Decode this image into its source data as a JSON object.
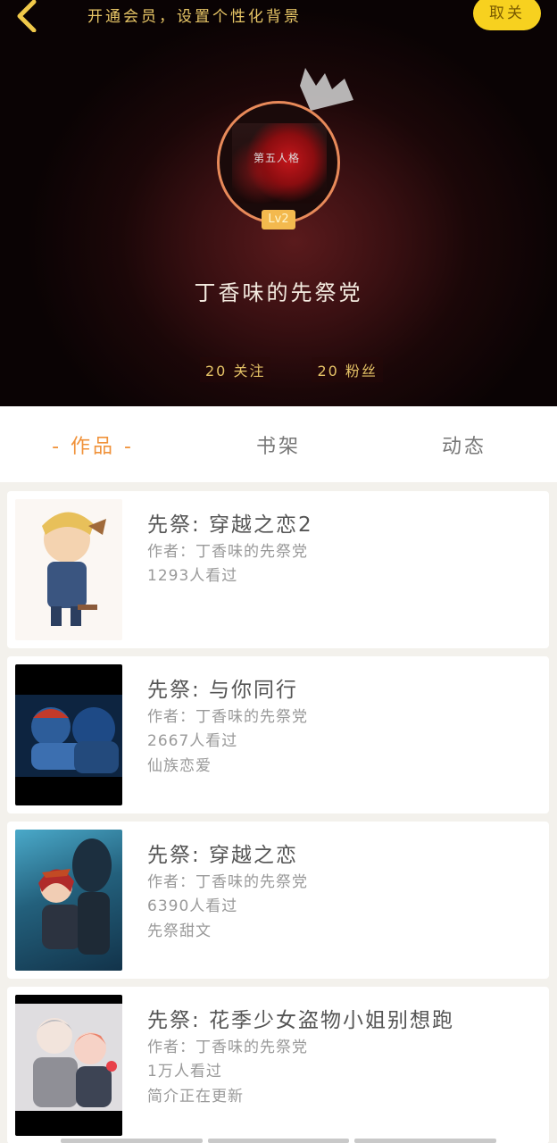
{
  "header": {
    "vip_tip": "开通会员，设置个性化背景",
    "follow_label": "取关",
    "username": "丁香味的先祭党",
    "level": "Lv2",
    "avatar_caption": "第五人格",
    "following": "20 关注",
    "followers": "20 粉丝"
  },
  "tabs": [
    {
      "label": "- 作品 -",
      "active": true
    },
    {
      "label": "书架",
      "active": false
    },
    {
      "label": "动态",
      "active": false
    }
  ],
  "works": [
    {
      "title": "先祭:  穿越之恋2",
      "author": "作者：丁香味的先祭党",
      "views": "1293人看过",
      "tag": ""
    },
    {
      "title": "先祭:  与你同行",
      "author": "作者：丁香味的先祭党",
      "views": "2667人看过",
      "tag": "仙族恋爱"
    },
    {
      "title": "先祭:  穿越之恋",
      "author": "作者：丁香味的先祭党",
      "views": "6390人看过",
      "tag": "先祭甜文"
    },
    {
      "title": "先祭:  花季少女盗物小姐别想跑",
      "author": "作者：丁香味的先祭党",
      "views": "1万人看过",
      "tag": "简介正在更新"
    }
  ],
  "colors": {
    "accent": "#f0923a",
    "follow_bg": "#f7d11f",
    "gold_text": "#e4c266"
  },
  "icons": {
    "back": "chevron-left-icon",
    "crown": "crown-icon"
  }
}
